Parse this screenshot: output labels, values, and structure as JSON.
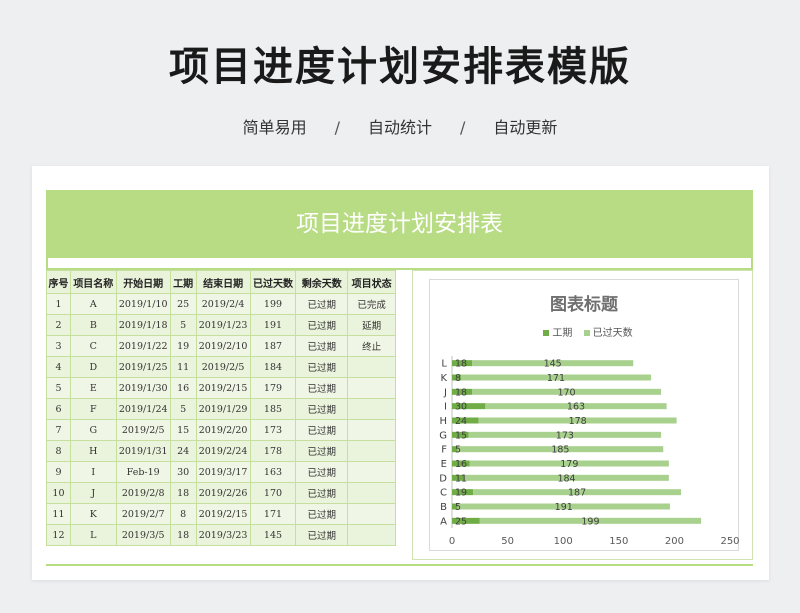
{
  "page": {
    "title": "项目进度计划安排表模版",
    "taglines": [
      "简单易用",
      "自动统计",
      "自动更新"
    ],
    "separator": "/"
  },
  "sheet": {
    "title": "项目进度计划安排表",
    "headers": [
      "序号",
      "项目名称",
      "开始日期",
      "工期",
      "结束日期",
      "已过天数",
      "剩余天数",
      "项目状态"
    ],
    "rows": [
      [
        "1",
        "A",
        "2019/1/10",
        "25",
        "2019/2/4",
        "199",
        "已过期",
        "已完成"
      ],
      [
        "2",
        "B",
        "2019/1/18",
        "5",
        "2019/1/23",
        "191",
        "已过期",
        "延期"
      ],
      [
        "3",
        "C",
        "2019/1/22",
        "19",
        "2019/2/10",
        "187",
        "已过期",
        "终止"
      ],
      [
        "4",
        "D",
        "2019/1/25",
        "11",
        "2019/2/5",
        "184",
        "已过期",
        ""
      ],
      [
        "5",
        "E",
        "2019/1/30",
        "16",
        "2019/2/15",
        "179",
        "已过期",
        ""
      ],
      [
        "6",
        "F",
        "2019/1/24",
        "5",
        "2019/1/29",
        "185",
        "已过期",
        ""
      ],
      [
        "7",
        "G",
        "2019/2/5",
        "15",
        "2019/2/20",
        "173",
        "已过期",
        ""
      ],
      [
        "8",
        "H",
        "2019/1/31",
        "24",
        "2019/2/24",
        "178",
        "已过期",
        ""
      ],
      [
        "9",
        "I",
        "Feb-19",
        "30",
        "2019/3/17",
        "163",
        "已过期",
        ""
      ],
      [
        "10",
        "J",
        "2019/2/8",
        "18",
        "2019/2/26",
        "170",
        "已过期",
        ""
      ],
      [
        "11",
        "K",
        "2019/2/7",
        "8",
        "2019/2/15",
        "171",
        "已过期",
        ""
      ],
      [
        "12",
        "L",
        "2019/3/5",
        "18",
        "2019/3/23",
        "145",
        "已过期",
        ""
      ]
    ]
  },
  "colors": {
    "accent": "#b8dc84",
    "bar_duration": "#70ad47",
    "bar_elapsed": "#a9d18e"
  },
  "chart_data": {
    "type": "bar",
    "orientation": "horizontal",
    "stacked": true,
    "title": "图表标题",
    "categories": [
      "A",
      "B",
      "C",
      "D",
      "E",
      "F",
      "G",
      "H",
      "I",
      "J",
      "K",
      "L"
    ],
    "series": [
      {
        "name": "工期",
        "values": [
          25,
          5,
          19,
          11,
          16,
          5,
          15,
          24,
          30,
          18,
          8,
          18
        ]
      },
      {
        "name": "已过天数",
        "values": [
          199,
          191,
          187,
          184,
          179,
          185,
          173,
          178,
          163,
          170,
          171,
          145
        ]
      }
    ],
    "xlim": [
      0,
      250
    ],
    "xticks": [
      0,
      50,
      100,
      150,
      200,
      250
    ],
    "legend": "top",
    "grid": false
  }
}
